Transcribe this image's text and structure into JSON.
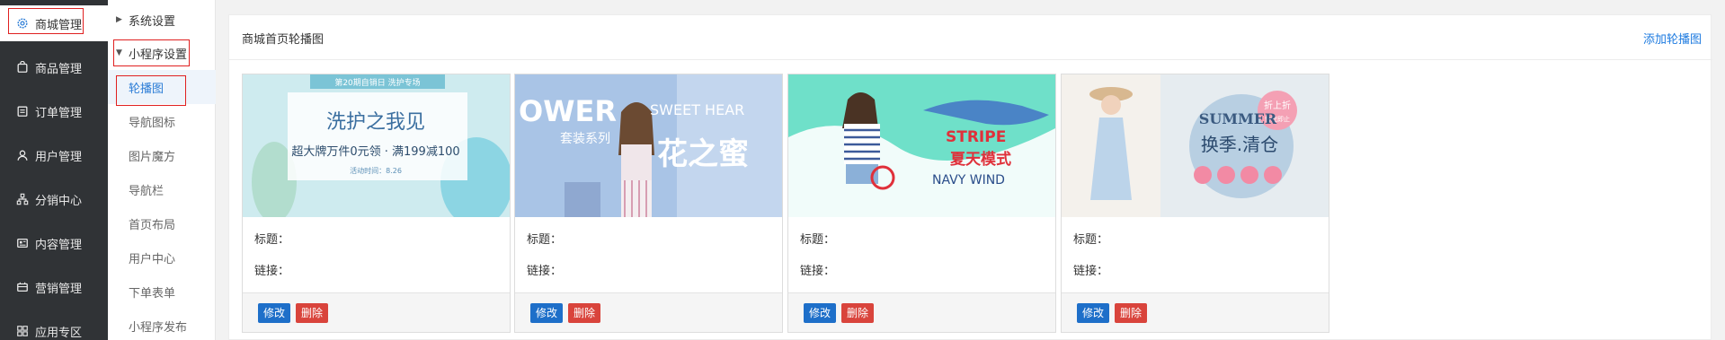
{
  "sidebar": {
    "items": [
      {
        "label": "商城管理",
        "icon": "gear-icon"
      },
      {
        "label": "商品管理",
        "icon": "bag-icon"
      },
      {
        "label": "订单管理",
        "icon": "order-icon"
      },
      {
        "label": "用户管理",
        "icon": "user-icon"
      },
      {
        "label": "分销中心",
        "icon": "network-icon"
      },
      {
        "label": "内容管理",
        "icon": "content-icon"
      },
      {
        "label": "营销管理",
        "icon": "marketing-icon"
      },
      {
        "label": "应用专区",
        "icon": "apps-icon"
      }
    ]
  },
  "submenu": {
    "system_settings": "系统设置",
    "miniapp_settings": "小程序设置",
    "items": [
      "轮播图",
      "导航图标",
      "图片魔方",
      "导航栏",
      "首页布局",
      "用户中心",
      "下单表单",
      "小程序发布"
    ]
  },
  "main": {
    "title": "商城首页轮播图",
    "add_label": "添加轮播图",
    "cards": [
      {
        "title_label": "标题：",
        "link_label": "链接：",
        "edit_label": "修改",
        "delete_label": "删除",
        "banner": {
          "top": "第20期自销日 洗护专场",
          "headline": "洗护之我见",
          "sub": "超大牌万件0元领 · 满199减100",
          "foot": "活动时间：8.26"
        }
      },
      {
        "title_label": "标题：",
        "link_label": "链接：",
        "edit_label": "修改",
        "delete_label": "删除",
        "banner": {
          "top": "OWER",
          "sub": "SWEET HEAR",
          "headline": "套装系列",
          "big": "花之蜜"
        }
      },
      {
        "title_label": "标题：",
        "link_label": "链接：",
        "edit_label": "修改",
        "delete_label": "删除",
        "banner": {
          "top": "STRIPE",
          "headline": "夏天模式",
          "sub": "NAVY WIND"
        }
      },
      {
        "title_label": "标题：",
        "link_label": "链接：",
        "edit_label": "修改",
        "delete_label": "删除",
        "banner": {
          "top": "SUMMER",
          "headline": "换季.清仓",
          "badge": "折上折",
          "badge_sub": "售完即止"
        }
      }
    ]
  }
}
